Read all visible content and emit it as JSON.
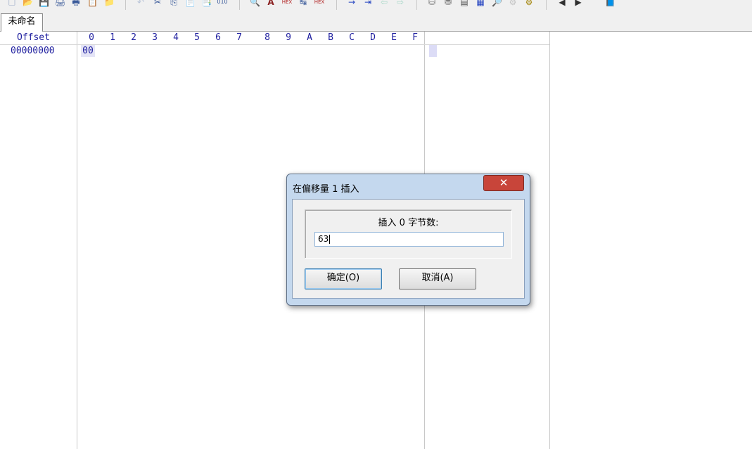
{
  "toolbar": {
    "icons": [
      {
        "name": "new-file-icon",
        "glyph": "🗋"
      },
      {
        "name": "open-folder-icon",
        "glyph": "📂"
      },
      {
        "name": "save-icon",
        "glyph": "💾"
      },
      {
        "name": "print-icon",
        "glyph": "🖨"
      },
      {
        "name": "print-preview-icon",
        "glyph": "🖶"
      },
      {
        "name": "properties-icon",
        "glyph": "📋"
      },
      {
        "name": "edit-folder-icon",
        "glyph": "📁"
      },
      {
        "name": "undo-icon",
        "glyph": "↶"
      },
      {
        "name": "cut-icon",
        "glyph": "✂"
      },
      {
        "name": "copy-icon",
        "glyph": "⎘"
      },
      {
        "name": "paste-icon",
        "glyph": "📄"
      },
      {
        "name": "paste-special-icon",
        "glyph": "📑"
      },
      {
        "name": "binary-icon",
        "glyph": "010"
      },
      {
        "name": "find-icon",
        "glyph": "🔍"
      },
      {
        "name": "find-text-icon",
        "glyph": "A"
      },
      {
        "name": "find-hex-icon",
        "glyph": "HEX"
      },
      {
        "name": "replace-icon",
        "glyph": "↹"
      },
      {
        "name": "replace-hex-icon",
        "glyph": "HEX"
      },
      {
        "name": "goto-icon",
        "glyph": "→"
      },
      {
        "name": "goto-offset-icon",
        "glyph": "⇥"
      },
      {
        "name": "back-icon",
        "glyph": "⇦"
      },
      {
        "name": "forward-icon",
        "glyph": "⇨"
      },
      {
        "name": "disk-icon",
        "glyph": "⛁"
      },
      {
        "name": "disk-open-icon",
        "glyph": "⛃"
      },
      {
        "name": "ram-icon",
        "glyph": "▤"
      },
      {
        "name": "calculator-icon",
        "glyph": "▦"
      },
      {
        "name": "analyze-icon",
        "glyph": "🔎"
      },
      {
        "name": "options-icon",
        "glyph": "⚙"
      },
      {
        "name": "gear-icon",
        "glyph": "⚙"
      },
      {
        "name": "prev-window-icon",
        "glyph": "◀"
      },
      {
        "name": "next-window-icon",
        "glyph": "▶"
      },
      {
        "name": "help-book-icon",
        "glyph": "📘"
      }
    ]
  },
  "tabs": [
    {
      "label": "未命名"
    }
  ],
  "hex_view": {
    "offset_header": "Offset",
    "columns": [
      "0",
      "1",
      "2",
      "3",
      "4",
      "5",
      "6",
      "7",
      "8",
      "9",
      "A",
      "B",
      "C",
      "D",
      "E",
      "F"
    ],
    "rows": [
      {
        "offset": "00000000",
        "bytes": [
          "00"
        ]
      }
    ],
    "colors": {
      "text": "#1f1f9f",
      "selection": "#e4e4f6",
      "grid": "#c8c8c8"
    }
  },
  "dialog": {
    "title": "在偏移量 1 插入",
    "close_label": "✕",
    "group_label": "插入 0 字节数:",
    "input_value": "63",
    "ok_label": "确定(O)",
    "cancel_label": "取消(A)"
  }
}
